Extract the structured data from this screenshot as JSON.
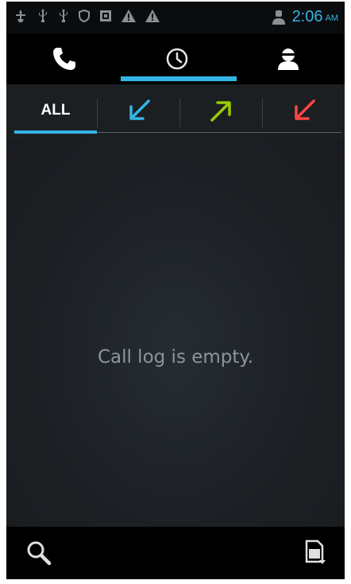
{
  "status_bar": {
    "time": "2:06",
    "ampm": "AM",
    "left_icons": [
      "usb-debug-icon",
      "usb-icon",
      "usb-icon",
      "shield-icon",
      "sim-icon",
      "warning-icon",
      "warning-icon"
    ],
    "right_icons": [
      "account-icon"
    ]
  },
  "top_tabs": [
    {
      "icon": "phone-icon"
    },
    {
      "icon": "clock-icon",
      "selected": true
    },
    {
      "icon": "contacts-icon"
    }
  ],
  "filter_tabs": [
    {
      "label": "ALL",
      "selected": true
    },
    {
      "icon": "incoming-call-icon",
      "color": "#33b5e5"
    },
    {
      "icon": "outgoing-call-icon",
      "color": "#99cc00"
    },
    {
      "icon": "missed-call-icon",
      "color": "#ff4444"
    }
  ],
  "main": {
    "empty_message": "Call log is empty."
  },
  "bottom_bar": {
    "left_icon": "search-icon",
    "right_icon": "menu-icon"
  },
  "colors": {
    "accent": "#33b5e5",
    "incoming": "#33b5e5",
    "outgoing": "#99cc00",
    "missed": "#ff4444"
  }
}
